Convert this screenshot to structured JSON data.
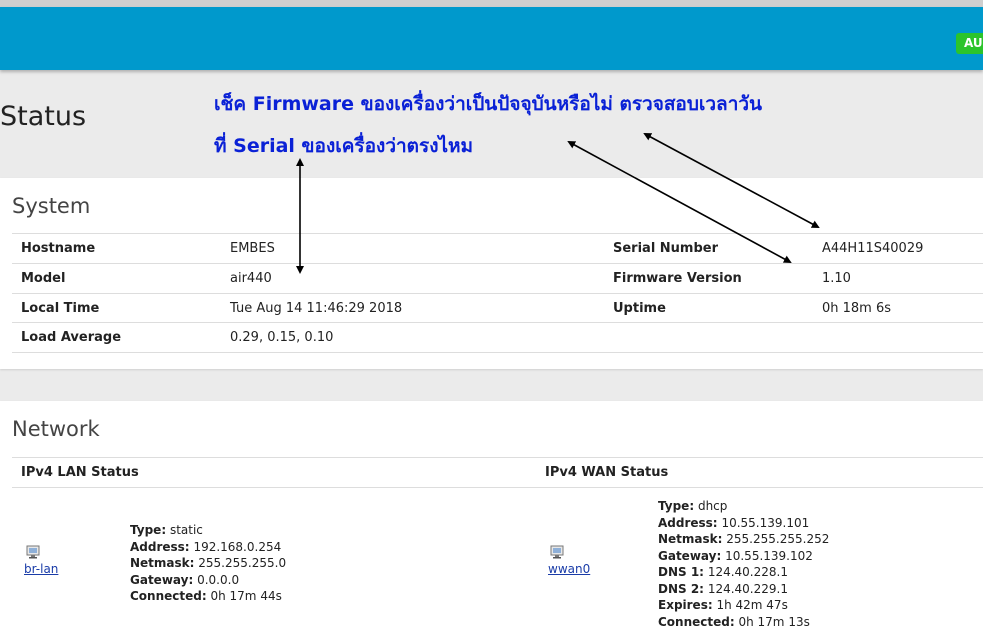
{
  "header": {
    "badge": "AU"
  },
  "page": {
    "title": "Status"
  },
  "annotations": {
    "line1": "เช็ค Firmware ของเครื่องว่าเป็นปัจจุบันหรือไม่ ตรวจสอบเวลาวัน",
    "line2": "ที่ Serial ของเครื่องว่าตรงไหม"
  },
  "system": {
    "title": "System",
    "rows": [
      {
        "label1": "Hostname",
        "value1": "EMBES",
        "label2": "Serial Number",
        "value2": "A44H11S40029"
      },
      {
        "label1": "Model",
        "value1": "air440",
        "label2": "Firmware Version",
        "value2": "1.10"
      },
      {
        "label1": "Local Time",
        "value1": "Tue Aug 14 11:46:29 2018",
        "label2": "Uptime",
        "value2": "0h 18m 6s"
      },
      {
        "label1": "Load Average",
        "value1": "0.29, 0.15, 0.10",
        "label2": "",
        "value2": ""
      }
    ]
  },
  "network": {
    "title": "Network",
    "lan_header": "IPv4 LAN Status",
    "wan_header": "IPv4 WAN Status",
    "lan": {
      "iface": "br-lan",
      "fields": [
        {
          "k": "Type:",
          "v": "static"
        },
        {
          "k": "Address:",
          "v": "192.168.0.254"
        },
        {
          "k": "Netmask:",
          "v": "255.255.255.0"
        },
        {
          "k": "Gateway:",
          "v": "0.0.0.0"
        },
        {
          "k": "Connected:",
          "v": "0h 17m 44s"
        }
      ]
    },
    "wan": {
      "iface": "wwan0",
      "fields": [
        {
          "k": "Type:",
          "v": "dhcp"
        },
        {
          "k": "Address:",
          "v": "10.55.139.101"
        },
        {
          "k": "Netmask:",
          "v": "255.255.255.252"
        },
        {
          "k": "Gateway:",
          "v": "10.55.139.102"
        },
        {
          "k": "DNS 1:",
          "v": "124.40.228.1"
        },
        {
          "k": "DNS 2:",
          "v": "124.40.229.1"
        },
        {
          "k": "Expires:",
          "v": "1h 42m 47s"
        },
        {
          "k": "Connected:",
          "v": "0h 17m 13s"
        }
      ]
    }
  },
  "colors": {
    "header": "#0099cc",
    "badge": "#2bc42b",
    "annotation": "#0a21d6"
  },
  "icons": {
    "interface": "network-interface-icon",
    "arrow": "double-arrow"
  }
}
